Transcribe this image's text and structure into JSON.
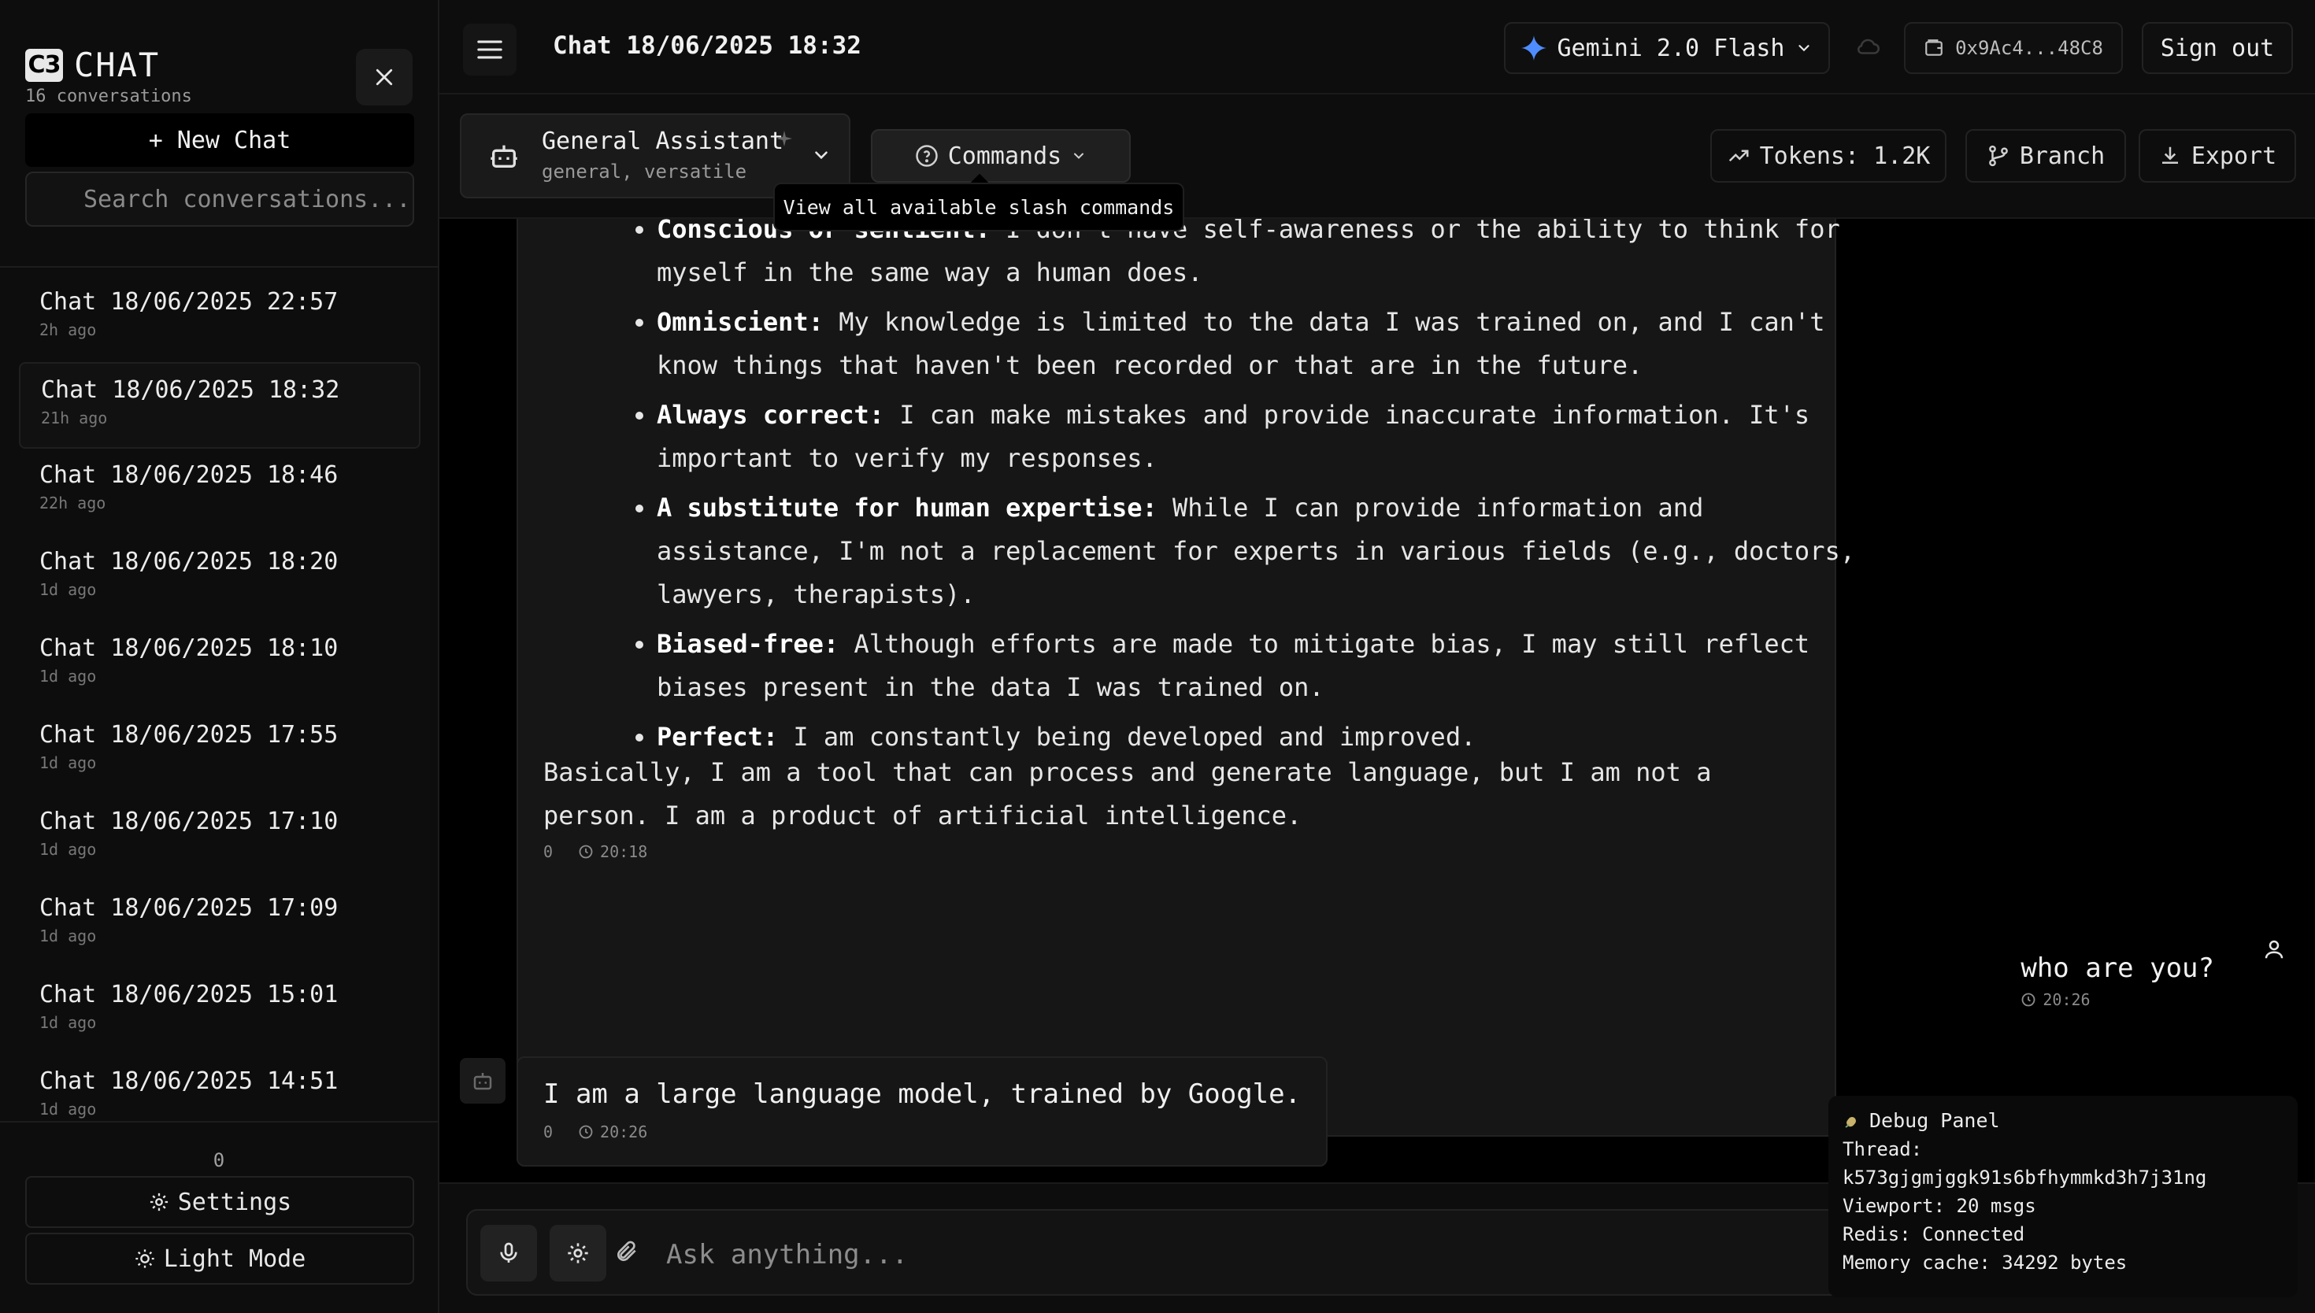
{
  "sidebar": {
    "brand_logo": "C3",
    "brand_name": "CHAT",
    "conversation_count": "16 conversations",
    "new_chat_label": "+ New Chat",
    "search_placeholder": "Search conversations...",
    "conversations": [
      {
        "title": "Chat 18/06/2025 22:57",
        "time": "2h ago"
      },
      {
        "title": "Chat 18/06/2025 18:32",
        "time": "21h ago"
      },
      {
        "title": "Chat 18/06/2025 18:46",
        "time": "22h ago"
      },
      {
        "title": "Chat 18/06/2025 18:20",
        "time": "1d ago"
      },
      {
        "title": "Chat 18/06/2025 18:10",
        "time": "1d ago"
      },
      {
        "title": "Chat 18/06/2025 17:55",
        "time": "1d ago"
      },
      {
        "title": "Chat 18/06/2025 17:10",
        "time": "1d ago"
      },
      {
        "title": "Chat 18/06/2025 17:09",
        "time": "1d ago"
      },
      {
        "title": "Chat 18/06/2025 15:01",
        "time": "1d ago"
      },
      {
        "title": "Chat 18/06/2025 14:51",
        "time": "1d ago"
      }
    ],
    "active_index": 1,
    "bottom_count": "0",
    "settings_label": "Settings",
    "theme_label": "Light Mode"
  },
  "header": {
    "title": "Chat 18/06/2025 18:32",
    "model_label": "Gemini 2.0 Flash",
    "wallet_label": "0x9Ac4...48C8",
    "signout_label": "Sign out"
  },
  "toolbar": {
    "assistant_name": "General Assistant",
    "assistant_sub": "general, versatile",
    "commands_label": "Commands",
    "commands_tooltip": "View all available slash commands",
    "tokens_label": "Tokens: 1.2K",
    "branch_label": "Branch",
    "export_label": "Export"
  },
  "messages": {
    "long_reply_items": [
      {
        "term": "Conscious or sentient:",
        "text": " I don't have self-awareness or the ability to think for myself in the same way a human does."
      },
      {
        "term": "Omniscient:",
        "text": " My knowledge is limited to the data I was trained on, and I can't know things that haven't been recorded or that are in the future."
      },
      {
        "term": "Always correct:",
        "text": " I can make mistakes and provide inaccurate information. It's important to verify my responses."
      },
      {
        "term": "A substitute for human expertise:",
        "text": " While I can provide information and assistance, I'm not a replacement for experts in various fields (e.g., doctors, lawyers, therapists)."
      },
      {
        "term": "Biased-free:",
        "text": " Although efforts are made to mitigate bias, I may still reflect biases present in the data I was trained on."
      },
      {
        "term": "Perfect:",
        "text": " I am constantly being developed and improved."
      }
    ],
    "long_reply_summary": "Basically, I am a tool that can process and generate language, but I am not a person. I am a product of artificial intelligence.",
    "long_reply_count": "0",
    "long_reply_time": "20:18",
    "user_text": "who are you?",
    "user_time": "20:26",
    "bot_text": "I am a large language model, trained by Google.",
    "bot_count": "0",
    "bot_time": "20:26"
  },
  "composer": {
    "placeholder": "Ask anything..."
  },
  "debug": {
    "title": "Debug Panel",
    "thread_label": "Thread:",
    "thread_id": "k573gjgmjggk91s6bfhymmkd3h7j31ng",
    "viewport": "Viewport: 20 msgs",
    "redis": "Redis: Connected",
    "memory": "Memory cache: 34292 bytes"
  },
  "colors": {
    "background": "#000000",
    "panel": "#0d0d0d",
    "bubble": "#161616",
    "gemini_star": "#4f8cff"
  }
}
